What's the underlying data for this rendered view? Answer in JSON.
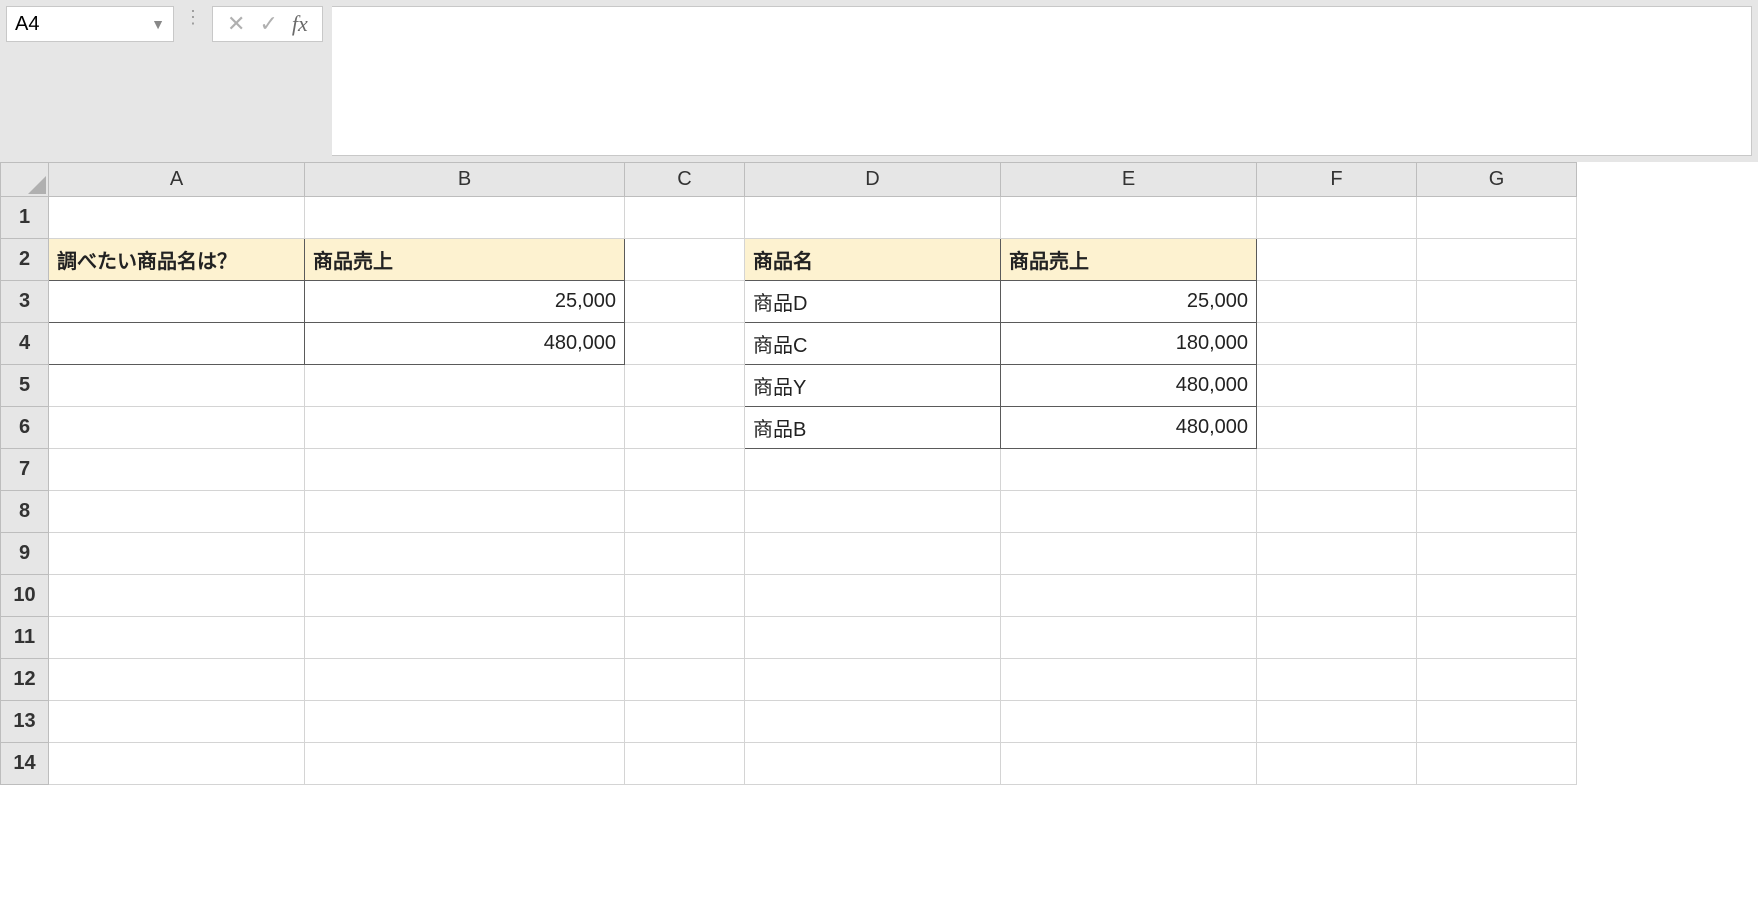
{
  "nameBox": {
    "value": "A4"
  },
  "formulaBar": {
    "value": ""
  },
  "columns": [
    "A",
    "B",
    "C",
    "D",
    "E",
    "F",
    "G"
  ],
  "rowHeaders": [
    "1",
    "2",
    "3",
    "4",
    "5",
    "6",
    "7",
    "8",
    "9",
    "10",
    "11",
    "12",
    "13",
    "14"
  ],
  "leftTable": {
    "headers": {
      "A": "調べたい商品名は？",
      "B": "商品売上"
    },
    "rows": [
      {
        "A": "",
        "B": "25,000"
      },
      {
        "A": "",
        "B": "480,000"
      }
    ]
  },
  "rightTable": {
    "headers": {
      "D": "商品名",
      "E": "商品売上"
    },
    "rows": [
      {
        "D": "商品D",
        "E": "25,000"
      },
      {
        "D": "商品C",
        "E": "180,000"
      },
      {
        "D": "商品Y",
        "E": "480,000"
      },
      {
        "D": "商品B",
        "E": "480,000"
      }
    ]
  },
  "icons": {
    "dropdown": "▼",
    "cancel": "✕",
    "confirm": "✓",
    "fx": "fx",
    "vdots": "⋮"
  }
}
